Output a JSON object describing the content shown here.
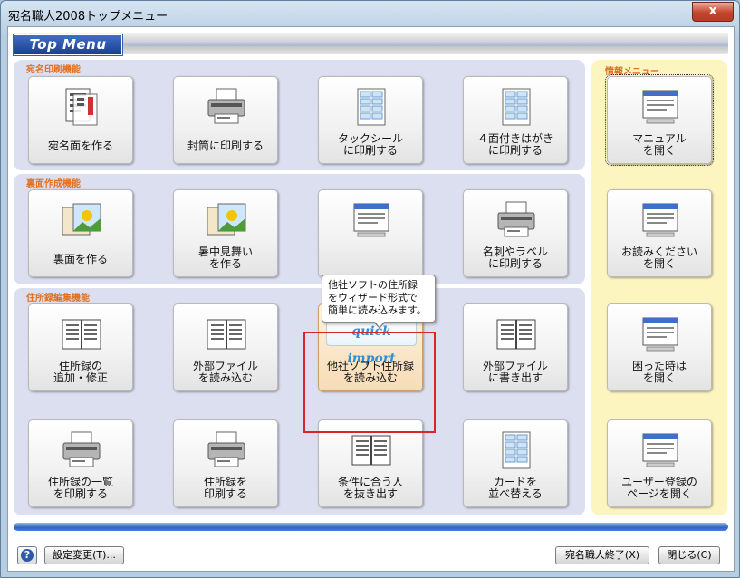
{
  "window": {
    "title": "宛名職人2008トップメニュー",
    "close_glyph": "x"
  },
  "header": {
    "logo_text": "Top Menu"
  },
  "sections": {
    "address_print": {
      "title": "宛名印刷機能",
      "items": [
        {
          "label": "宛名面を作る",
          "icon": "postcard-address-icon"
        },
        {
          "label": "封筒に印刷する",
          "icon": "printer-envelope-icon"
        },
        {
          "label": "タックシール\nに印刷する",
          "icon": "label-sheet-icon"
        },
        {
          "label": "４面付きはがき\nに印刷する",
          "icon": "four-postcard-sheet-icon"
        }
      ]
    },
    "back_side": {
      "title": "裏面作成機能",
      "items": [
        {
          "label": "裏面を作る",
          "icon": "greeting-card-icon"
        },
        {
          "label": "暑中見舞い\nを作る",
          "icon": "summer-greeting-card-icon"
        },
        {
          "label": "",
          "icon": "card-layout-icon"
        },
        {
          "label": "名刺やラベル\nに印刷する",
          "icon": "business-card-printer-icon"
        }
      ]
    },
    "address_book": {
      "title": "住所録編集機能",
      "items": [
        {
          "label": "住所録の\n追加・修正",
          "icon": "address-book-pen-icon"
        },
        {
          "label": "外部ファイル\nを読み込む",
          "icon": "import-file-icon"
        },
        {
          "label": "他社ソフト住所録\nを読み込む",
          "icon": "quick-import-icon"
        },
        {
          "label": "外部ファイル\nに書き出す",
          "icon": "export-file-icon"
        },
        {
          "label": "住所録の一覧\nを印刷する",
          "icon": "print-list-icon"
        },
        {
          "label": "住所録を\n印刷する",
          "icon": "print-address-book-icon"
        },
        {
          "label": "条件に合う人\nを抜き出す",
          "icon": "filter-people-icon"
        },
        {
          "label": "カードを\n並べ替える",
          "icon": "sort-cards-icon"
        }
      ]
    }
  },
  "info_menu": {
    "title": "情報メニュー",
    "items": [
      {
        "label": "マニュアル\nを開く",
        "icon": "manual-icon"
      },
      {
        "label": "お読みください\nを開く",
        "icon": "readme-icon"
      },
      {
        "label": "困った時は\nを開く",
        "icon": "troubleshoot-icon"
      },
      {
        "label": "ユーザー登録の\nページを開く",
        "icon": "user-registration-icon"
      }
    ]
  },
  "quick_import": {
    "logo_text": "quick import",
    "tooltip": "他社ソフトの住所録\nをウィザード形式で\n簡単に読み込みます。"
  },
  "footer": {
    "help_glyph": "?",
    "settings_label": "設定変更(T)...",
    "exit_label": "宛名職人終了(X)",
    "close_label": "閉じる(C)"
  },
  "colors": {
    "section_bg": "#dcdff0",
    "info_bg": "#fdf5c0",
    "section_title": "#e07020",
    "highlight": "#d8242a",
    "accent_blue": "#2f62c6"
  }
}
